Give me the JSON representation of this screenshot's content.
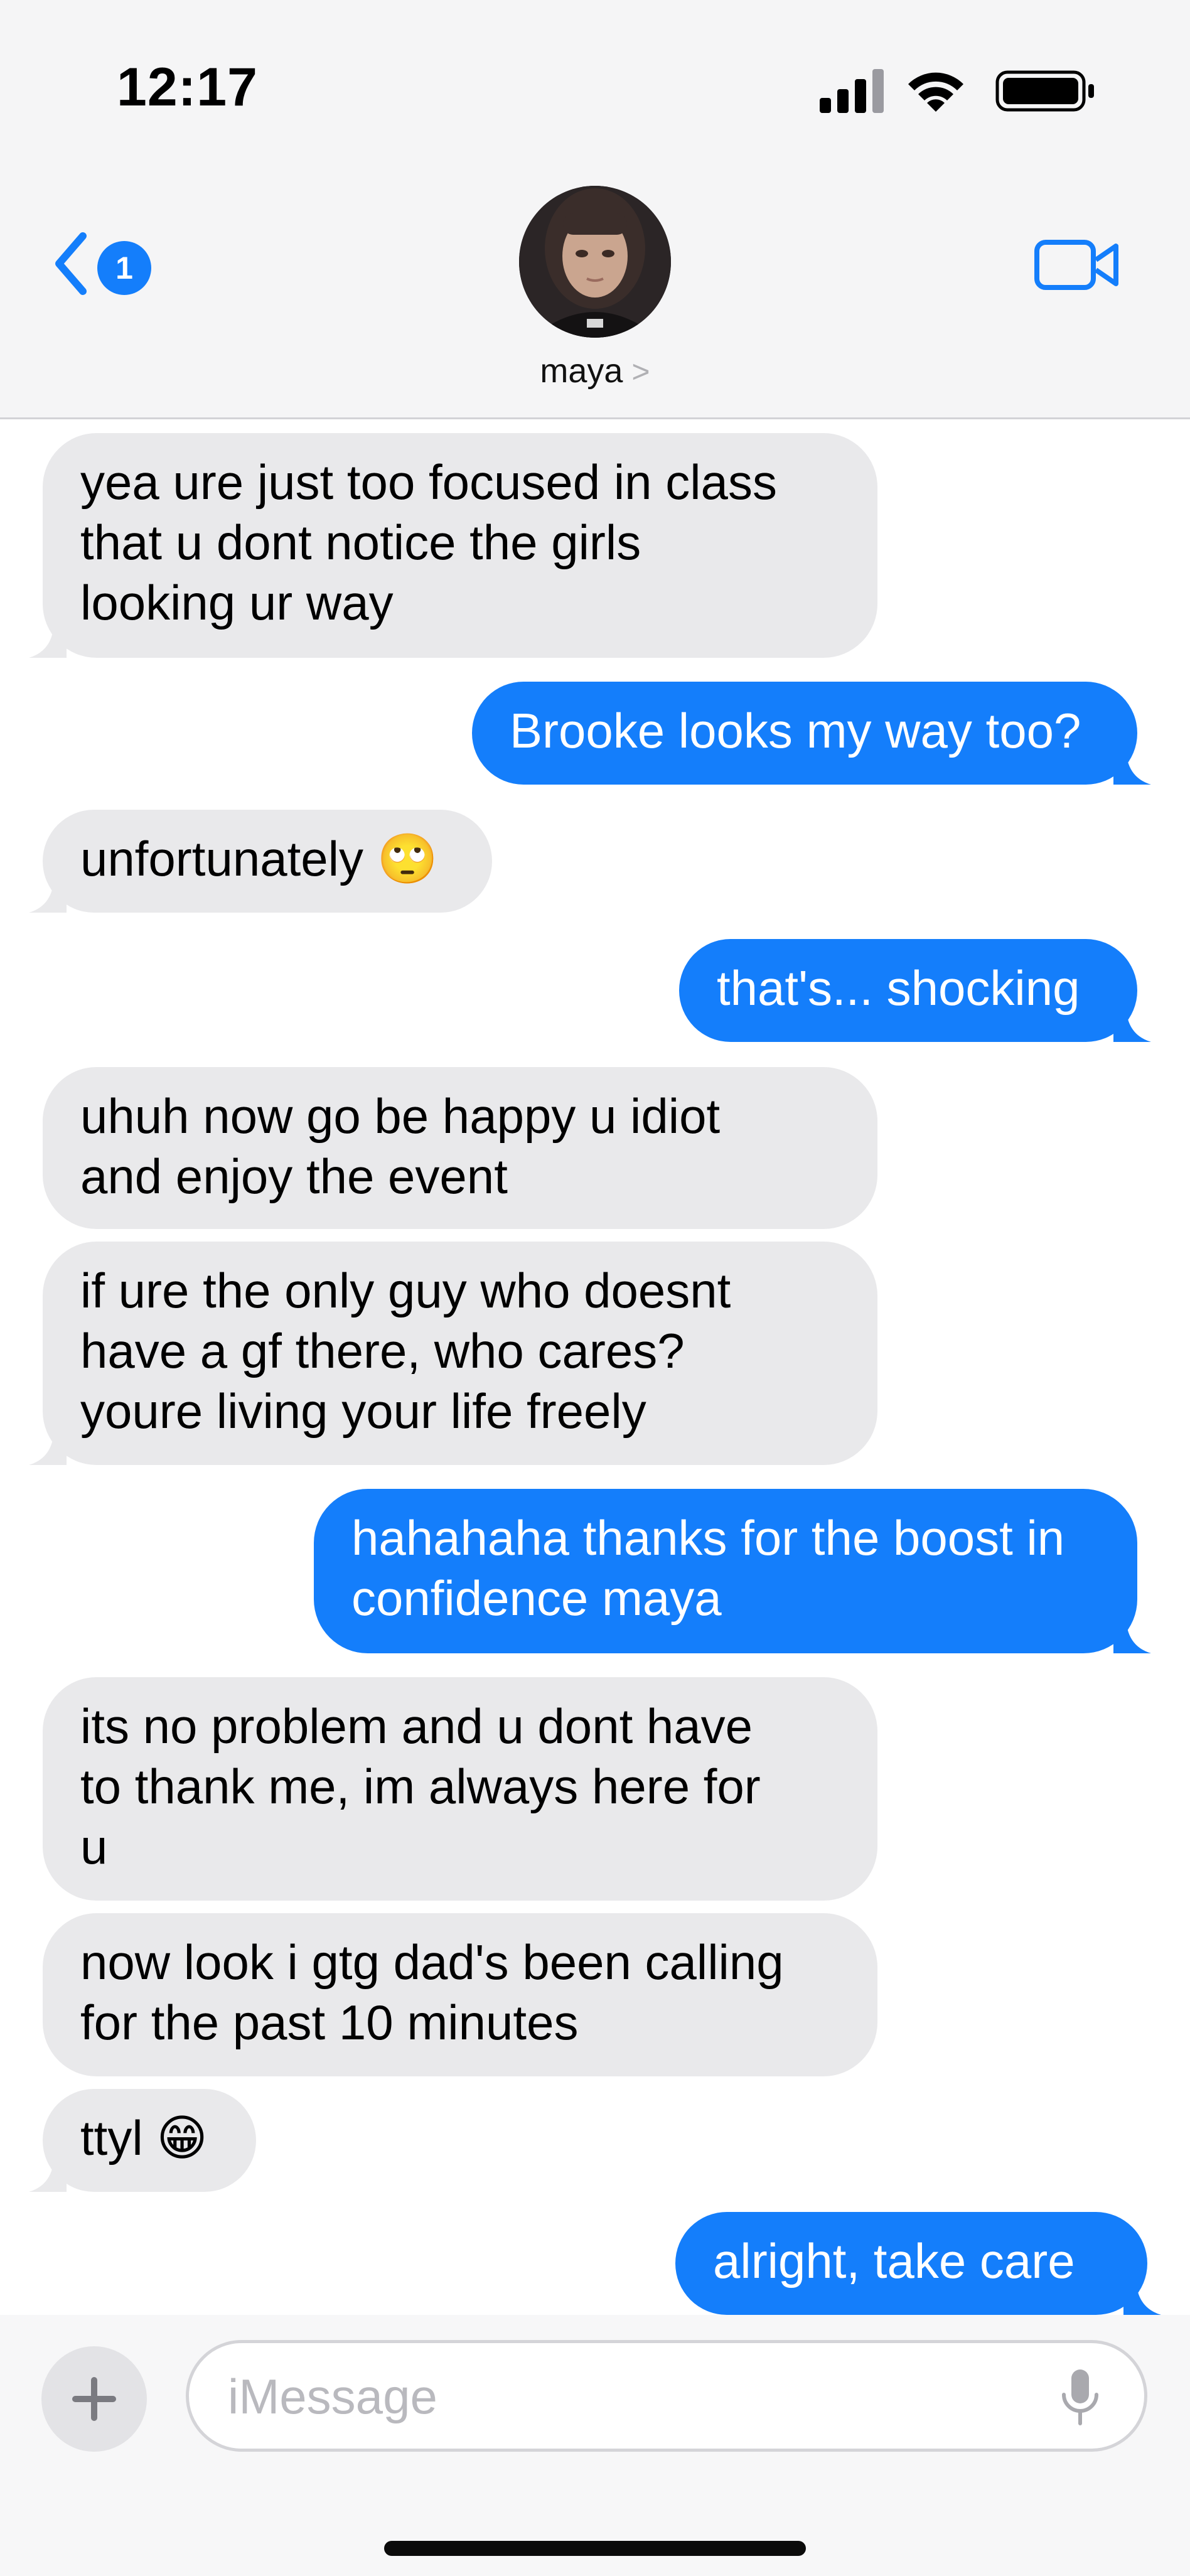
{
  "status_bar": {
    "time": "12:17"
  },
  "header": {
    "back_badge_count": "1",
    "contact_name": "maya",
    "contact_chevron": ">"
  },
  "messages": [
    {
      "side": "received",
      "text": "yea ure just too focused in class\nthat u dont notice the girls\nlooking ur way"
    },
    {
      "side": "sent",
      "text": "Brooke looks my way too?"
    },
    {
      "side": "received",
      "text": "unfortunately 🙄"
    },
    {
      "side": "sent",
      "text": "that's... shocking"
    },
    {
      "side": "received",
      "text": "uhuh now go be happy u idiot\nand enjoy the event"
    },
    {
      "side": "received",
      "text": "if ure the only guy who doesnt\nhave a gf there, who cares?\nyoure living your life freely"
    },
    {
      "side": "sent",
      "text": "hahahaha thanks for the boost in\nconfidence maya"
    },
    {
      "side": "received",
      "text": "its no problem and u dont have\nto thank me, im always here for\nu"
    },
    {
      "side": "received",
      "text": "now look i gtg dad's been calling\nfor the past 10 minutes"
    },
    {
      "side": "received",
      "text": "ttyl 😁"
    },
    {
      "side": "sent",
      "text": "alright, take care"
    }
  ],
  "compose": {
    "placeholder": "iMessage",
    "value": ""
  },
  "colors": {
    "accent": "#147efb",
    "received_bubble": "#e9e9eb",
    "header_bg": "#f5f5f6"
  },
  "icons": {
    "back": "chevron-back-icon",
    "video": "video-camera-icon",
    "plus": "plus-icon",
    "mic": "microphone-icon",
    "signal": "cellular-signal-icon",
    "wifi": "wifi-icon",
    "battery": "battery-icon"
  }
}
